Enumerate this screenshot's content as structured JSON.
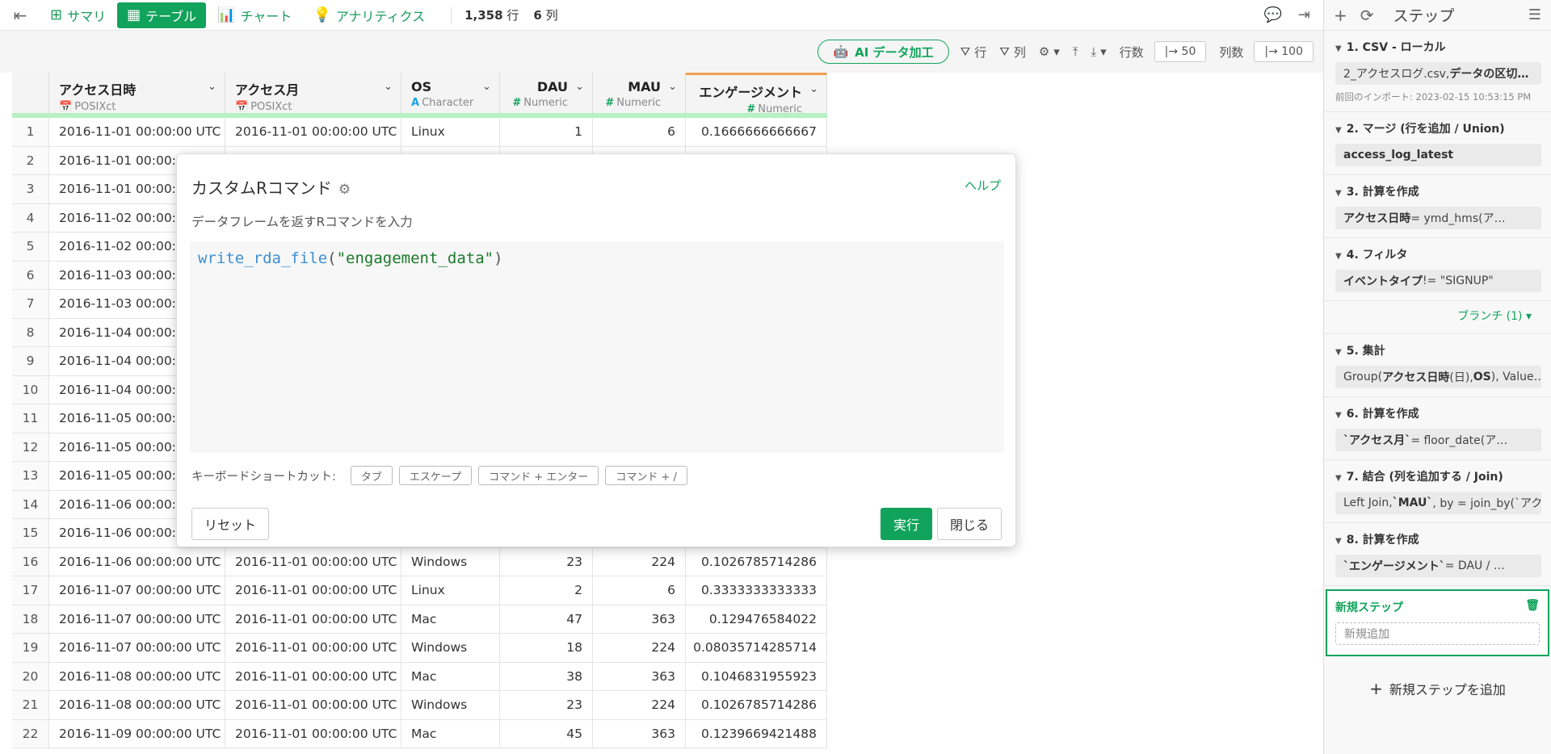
{
  "topbar": {
    "tabs": [
      {
        "label": "サマリ",
        "icon": "summary-icon"
      },
      {
        "label": "テーブル",
        "icon": "table-icon"
      },
      {
        "label": "チャート",
        "icon": "chart-icon"
      },
      {
        "label": "アナリティクス",
        "icon": "bulb-icon"
      }
    ],
    "rows_count": "1,358",
    "rows_unit": "行",
    "cols_count": "6",
    "cols_unit": "列"
  },
  "toolbar": {
    "ai_label": "AI データ加工",
    "row_filter": "行",
    "col_filter": "列",
    "rows_label": "行数",
    "rows_value": "|→ 50",
    "cols_label": "列数",
    "cols_value": "|→ 100"
  },
  "table": {
    "columns": [
      {
        "name": "アクセス日時",
        "type": "POSIXct"
      },
      {
        "name": "アクセス月",
        "type": "POSIXct"
      },
      {
        "name": "OS",
        "type": "Character"
      },
      {
        "name": "DAU",
        "type": "Numeric"
      },
      {
        "name": "MAU",
        "type": "Numeric"
      },
      {
        "name": "エンゲージメント",
        "type": "Numeric"
      }
    ],
    "rows": [
      [
        "1",
        "2016-11-01 00:00:00 UTC",
        "2016-11-01 00:00:00 UTC",
        "Linux",
        "1",
        "6",
        "0.1666666666667"
      ],
      [
        "2",
        "2016-11-01 00:00:",
        "",
        "",
        "",
        "",
        ""
      ],
      [
        "3",
        "2016-11-01 00:00:",
        "",
        "",
        "",
        "",
        ""
      ],
      [
        "4",
        "2016-11-02 00:00:",
        "",
        "",
        "",
        "",
        ""
      ],
      [
        "5",
        "2016-11-02 00:00:",
        "",
        "",
        "",
        "",
        ""
      ],
      [
        "6",
        "2016-11-03 00:00:",
        "",
        "",
        "",
        "",
        ""
      ],
      [
        "7",
        "2016-11-03 00:00:",
        "",
        "",
        "",
        "",
        ""
      ],
      [
        "8",
        "2016-11-04 00:00:",
        "",
        "",
        "",
        "",
        ""
      ],
      [
        "9",
        "2016-11-04 00:00:",
        "",
        "",
        "",
        "",
        ""
      ],
      [
        "10",
        "2016-11-04 00:00:",
        "",
        "",
        "",
        "",
        ""
      ],
      [
        "11",
        "2016-11-05 00:00:",
        "",
        "",
        "",
        "",
        ""
      ],
      [
        "12",
        "2016-11-05 00:00:",
        "",
        "",
        "",
        "",
        ""
      ],
      [
        "13",
        "2016-11-05 00:00:",
        "",
        "",
        "",
        "",
        ""
      ],
      [
        "14",
        "2016-11-06 00:00:",
        "",
        "",
        "",
        "",
        ""
      ],
      [
        "15",
        "2016-11-06 00:00:",
        "",
        "",
        "",
        "",
        ""
      ],
      [
        "16",
        "2016-11-06 00:00:00 UTC",
        "2016-11-01 00:00:00 UTC",
        "Windows",
        "23",
        "224",
        "0.1026785714286"
      ],
      [
        "17",
        "2016-11-07 00:00:00 UTC",
        "2016-11-01 00:00:00 UTC",
        "Linux",
        "2",
        "6",
        "0.3333333333333"
      ],
      [
        "18",
        "2016-11-07 00:00:00 UTC",
        "2016-11-01 00:00:00 UTC",
        "Mac",
        "47",
        "363",
        "0.129476584022"
      ],
      [
        "19",
        "2016-11-07 00:00:00 UTC",
        "2016-11-01 00:00:00 UTC",
        "Windows",
        "18",
        "224",
        "0.08035714285714"
      ],
      [
        "20",
        "2016-11-08 00:00:00 UTC",
        "2016-11-01 00:00:00 UTC",
        "Mac",
        "38",
        "363",
        "0.1046831955923"
      ],
      [
        "21",
        "2016-11-08 00:00:00 UTC",
        "2016-11-01 00:00:00 UTC",
        "Windows",
        "23",
        "224",
        "0.1026785714286"
      ],
      [
        "22",
        "2016-11-09 00:00:00 UTC",
        "2016-11-01 00:00:00 UTC",
        "Mac",
        "45",
        "363",
        "0.1239669421488"
      ]
    ]
  },
  "dialog": {
    "title": "カスタムRコマンド",
    "help": "ヘルプ",
    "description": "データフレームを返すRコマンドを入力",
    "code_fn": "write_rda_file",
    "code_open": "(",
    "code_str": "\"engagement_data\"",
    "code_close": ")",
    "shortcuts_label": "キーボードショートカット:",
    "shortcuts": [
      "タブ",
      "エスケープ",
      "コマンド + エンター",
      "コマンド + /"
    ],
    "reset": "リセット",
    "run": "実行",
    "close": "閉じる"
  },
  "sidebar": {
    "title": "ステップ",
    "steps": [
      {
        "title": "1. CSV - ローカル",
        "body_html": "2_アクセスログ.csv, <b>データの区切…</b>",
        "note": "前回のインポート: 2023-02-15 10:53:15 PM"
      },
      {
        "title": "2. マージ (行を追加 / Union)",
        "body_html": "<b>access_log_latest</b>"
      },
      {
        "title": "3. 計算を作成",
        "body_html": "<b>アクセス日時</b> = ymd_hms(ア…"
      },
      {
        "title": "4. フィルタ",
        "body_html": "<b>イベントタイプ</b> != \"SIGNUP\""
      }
    ],
    "branch": "ブランチ (1)",
    "steps2": [
      {
        "title": "5. 集計",
        "body_html": "Group(<b>アクセス日時</b> (日), <b>OS</b>), Value…"
      },
      {
        "title": "6. 計算を作成",
        "body_html": "<b>`アクセス月`</b> = floor_date(ア…"
      },
      {
        "title": "7. 結合 (列を追加する / Join)",
        "body_html": "Left Join, <b>`MAU`</b>, by = join_by(`アク…"
      },
      {
        "title": "8. 計算を作成",
        "body_html": "<b>`エンゲージメント`</b> = DAU / …"
      }
    ],
    "new_step_title": "新規ステップ",
    "new_step_placeholder": "新規追加",
    "add_step": "新規ステップを追加"
  }
}
